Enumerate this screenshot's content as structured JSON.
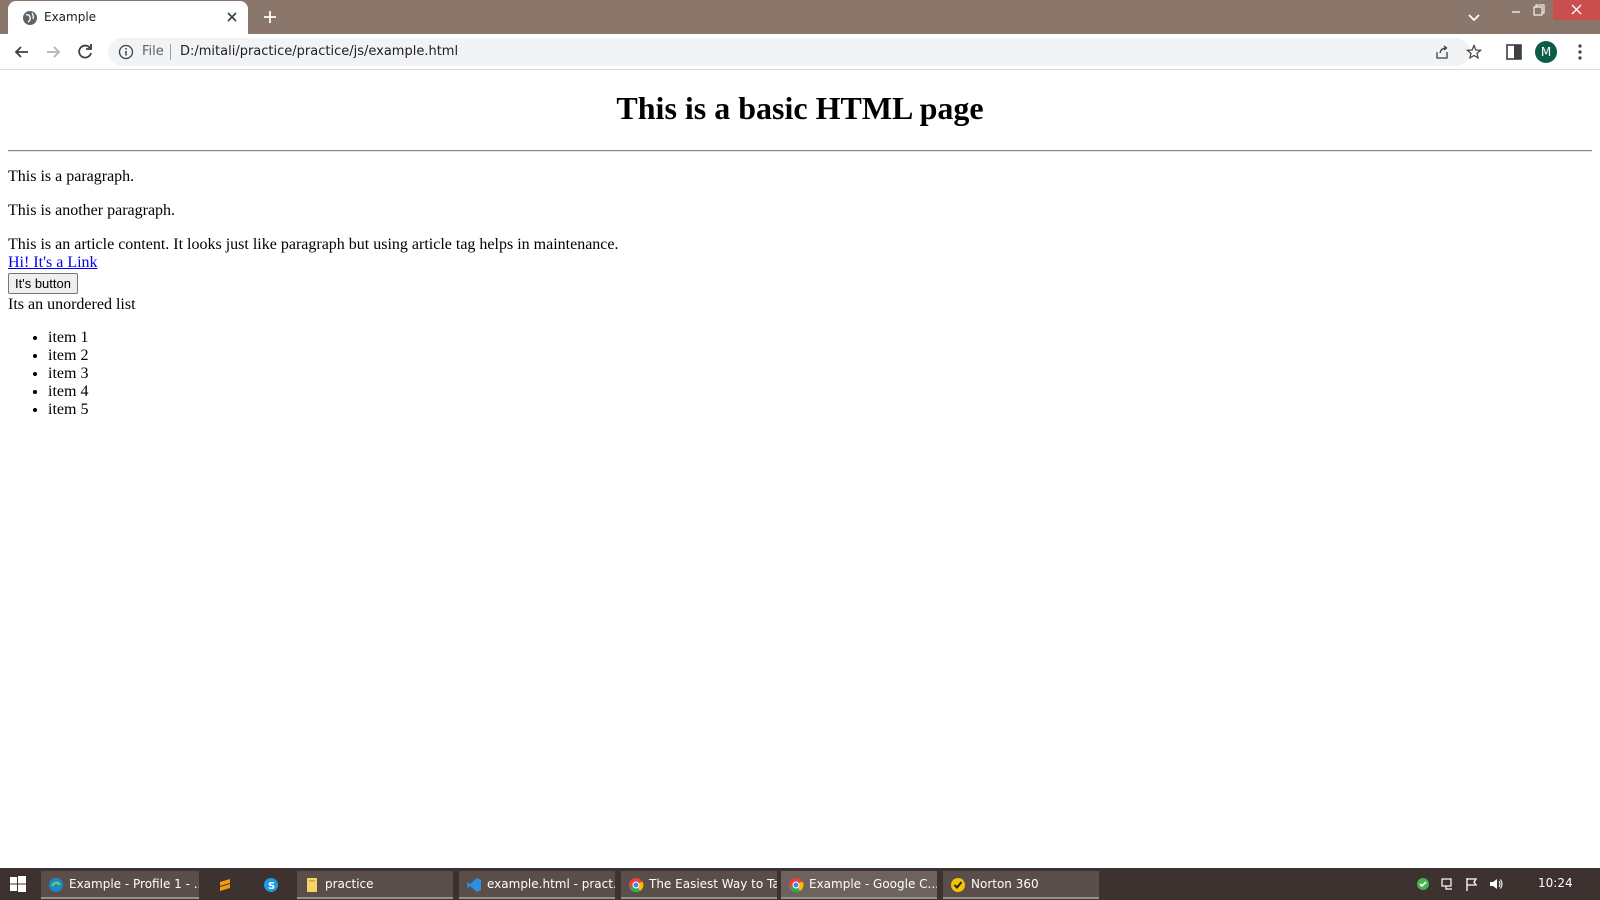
{
  "browser": {
    "tab": {
      "title": "Example"
    },
    "omnibox": {
      "scheme_label": "File",
      "url": "D:/mitali/practice/practice/js/example.html"
    },
    "profile_initial": "M"
  },
  "page": {
    "heading": "This is a basic HTML page",
    "paragraphs": [
      "This is a paragraph.",
      "This is another paragraph."
    ],
    "article_text": "This is an article content. It looks just like paragraph but using article tag helps in maintenance.",
    "link_text": "Hi! It's a Link",
    "button_label": "It's button",
    "list_caption": "Its an unordered list",
    "list_items": [
      "item 1",
      "item 2",
      "item 3",
      "item 4",
      "item 5"
    ]
  },
  "taskbar": {
    "items": [
      {
        "label": "Example - Profile 1 - ...",
        "icon": "edge-icon"
      },
      {
        "label": "",
        "icon": "sublime-icon"
      },
      {
        "label": "",
        "icon": "skype-icon"
      },
      {
        "label": "practice",
        "icon": "folder-icon"
      },
      {
        "label": "example.html - pract...",
        "icon": "vscode-icon"
      },
      {
        "label": "The Easiest Way to Ta...",
        "icon": "chrome-icon"
      },
      {
        "label": "Example - Google C...",
        "icon": "chrome-icon"
      },
      {
        "label": "Norton 360",
        "icon": "norton-icon"
      }
    ],
    "clock": "10:24"
  },
  "colors": {
    "titlebar": "#8a766b",
    "window_close": "#c94f4f",
    "link": "#0000ee",
    "avatar": "#0b5c48",
    "taskbar": "#3d3230"
  }
}
